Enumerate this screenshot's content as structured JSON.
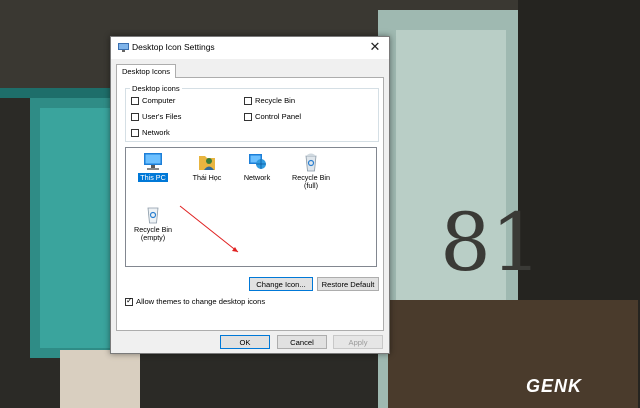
{
  "window": {
    "title": "Desktop Icon Settings",
    "close_glyph": "✕"
  },
  "tab": {
    "label": "Desktop Icons"
  },
  "group": {
    "label": "Desktop icons",
    "checkboxes": [
      {
        "label": "Computer",
        "checked": false
      },
      {
        "label": "User's Files",
        "checked": false
      },
      {
        "label": "Network",
        "checked": false
      },
      {
        "label": "Recycle Bin",
        "checked": false
      },
      {
        "label": "Control Panel",
        "checked": false
      }
    ]
  },
  "icons": [
    {
      "label": "This PC",
      "icon": "computer-icon",
      "selected": true
    },
    {
      "label": "Thái Học",
      "icon": "user-folder-icon",
      "selected": false
    },
    {
      "label": "Network",
      "icon": "network-icon",
      "selected": false
    },
    {
      "label": "Recycle Bin\n(full)",
      "label_line1": "Recycle Bin",
      "label_line2": "(full)",
      "icon": "recycle-bin-full-icon",
      "selected": false
    },
    {
      "label_line1": "Recycle Bin",
      "label_line2": "(empty)",
      "icon": "recycle-bin-empty-icon",
      "selected": false
    }
  ],
  "buttons": {
    "change_icon": "Change Icon...",
    "restore_default": "Restore Default",
    "ok": "OK",
    "cancel": "Cancel",
    "apply": "Apply"
  },
  "allow_themes": {
    "label": "Allow themes to change desktop icons",
    "checked": true
  },
  "watermark": "GENK",
  "colors": {
    "accent": "#0078d7",
    "arrow": "#e02020"
  }
}
